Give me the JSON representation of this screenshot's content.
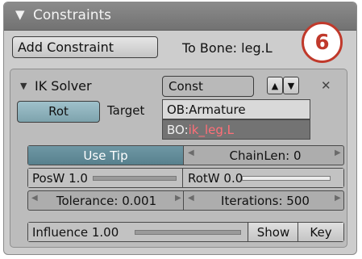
{
  "panel": {
    "title": "Constraints",
    "add_constraint_label": "Add Constraint",
    "to_bone_label": "To Bone: leg.L",
    "badge_number": "6"
  },
  "constraint": {
    "name": "IK Solver",
    "type": "Const",
    "rot_label": "Rot",
    "target_label": "Target",
    "ob_field": "OB:Armature",
    "bo_prefix": "BO:",
    "bo_value": "ik_leg.L",
    "use_tip_label": "Use Tip",
    "chainlen_label": "ChainLen: 0",
    "posw_label": "PosW 1.0",
    "posw_level": 1.0,
    "rotw_label": "RotW 0.0",
    "rotw_level": 0.0,
    "tolerance_label": "Tolerance: 0.001",
    "iterations_label": "Iterations: 500",
    "influence_label": "Influence 1.00",
    "influence_level": 1.0,
    "show_label": "Show",
    "key_label": "Key"
  },
  "colors": {
    "header_bg": "#7d7d7d",
    "panel_bg": "#cdcdcd",
    "toggle_active": "#6f98a5",
    "badge_red": "#c0392b",
    "bone_text": "#ff6f78"
  }
}
